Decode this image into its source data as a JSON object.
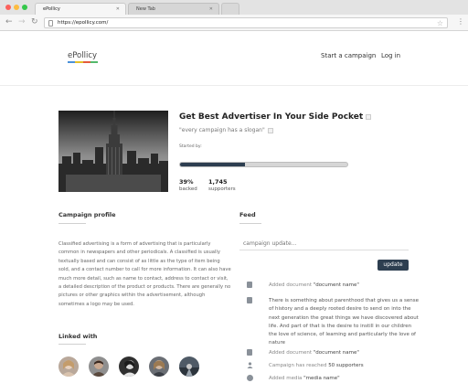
{
  "browser": {
    "tabs": [
      {
        "label": "ePollicy"
      },
      {
        "label": "New Tab"
      }
    ],
    "url": "https://epollicy.com/"
  },
  "site": {
    "logo": "ePollicy",
    "logo_colors": [
      "#4a90d9",
      "#e4c02b",
      "#e35b3c",
      "#53b96b"
    ],
    "nav": {
      "start_campaign": "Start a campaign",
      "login": "Log in"
    }
  },
  "campaign": {
    "title": "Get Best Advertiser In Your Side Pocket",
    "slogan": "\"every campaign has a slogan\"",
    "started_by": "Started by:",
    "progress_percent": 39,
    "backed_value": "39%",
    "backed_label": "backed",
    "supporters_value": "1,745",
    "supporters_label": "supporters"
  },
  "profile": {
    "heading": "Campaign profile",
    "text": "Classified advertising is a form of advertising that is particularly common in newspapers and other periodicals. A classified is usually textually based and can consist of as little as the type of item being sold, and a contact number to call for more information. It can also have much more detail, such as name to contact, address to contact or visit, a detailed description of the product or products. There are generally no pictures or other graphics within the advertisement, although sometimes a logo may be used."
  },
  "linked": {
    "heading": "Linked with"
  },
  "feed": {
    "heading": "Feed",
    "placeholder": "campaign update...",
    "update_label": "update",
    "items": [
      {
        "prefix": "Added document ",
        "name": "\"document name\""
      },
      {
        "body": "There is something about parenthood that gives us a sense of history and a deeply rooted desire to send on into the next generation the great things we have discovered about life. And part of that is the desire to instill in our children the love of science, of learning and particularly the love of nature"
      },
      {
        "prefix": "Added document ",
        "name": "\"document name\""
      },
      {
        "prefix": "Campaign has reached ",
        "name": "50 supporters"
      },
      {
        "prefix": "Added media ",
        "name": "\"media name\""
      }
    ]
  }
}
